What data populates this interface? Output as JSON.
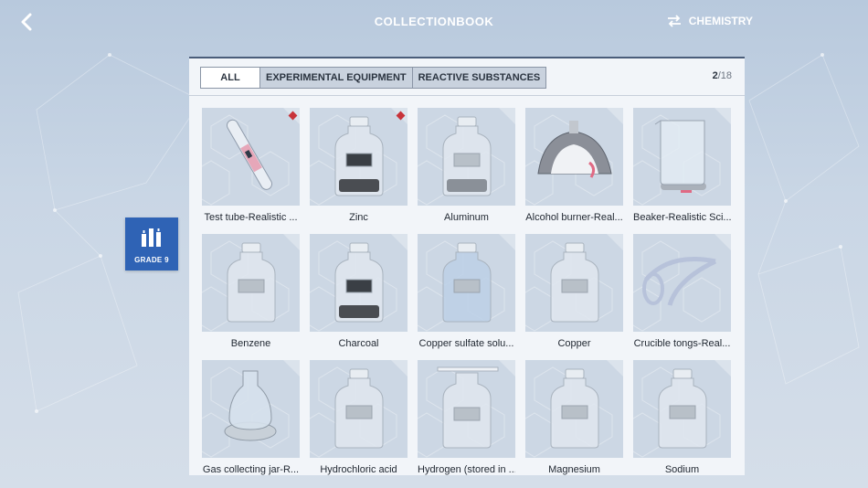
{
  "header": {
    "title": "COLLECTIONBOOK",
    "subject": "CHEMISTRY"
  },
  "grade": {
    "label": "GRADE 9"
  },
  "tabs": [
    {
      "label": "ALL",
      "active": true
    },
    {
      "label": "EXPERIMENTAL EQUIPMENT",
      "active": false
    },
    {
      "label": "REACTIVE SUBSTANCES",
      "active": false
    }
  ],
  "counter": {
    "current": "2",
    "total": "/18"
  },
  "items": [
    {
      "name": "Test tube-Realistic ...",
      "icon": "test-tube",
      "new": true
    },
    {
      "name": "Zinc",
      "icon": "jar-dark",
      "new": true
    },
    {
      "name": "Aluminum",
      "icon": "jar-grey",
      "new": false
    },
    {
      "name": "Alcohol burner-Real...",
      "icon": "burner",
      "new": false
    },
    {
      "name": "Beaker-Realistic Sci...",
      "icon": "beaker",
      "new": false
    },
    {
      "name": "Benzene",
      "icon": "jar-empty",
      "new": false
    },
    {
      "name": "Charcoal",
      "icon": "jar-dark",
      "new": false
    },
    {
      "name": "Copper sulfate solu...",
      "icon": "jar-blue",
      "new": false
    },
    {
      "name": "Copper",
      "icon": "jar-empty",
      "new": false
    },
    {
      "name": "Crucible tongs-Real...",
      "icon": "tongs",
      "new": false
    },
    {
      "name": "Gas collecting jar-R...",
      "icon": "gas-jar",
      "new": false
    },
    {
      "name": "Hydrochloric acid",
      "icon": "jar-empty",
      "new": false
    },
    {
      "name": "Hydrogen (stored in ...",
      "icon": "jar-plate",
      "new": false
    },
    {
      "name": "Magnesium",
      "icon": "jar-empty",
      "new": false
    },
    {
      "name": "Sodium",
      "icon": "jar-empty",
      "new": false
    }
  ]
}
